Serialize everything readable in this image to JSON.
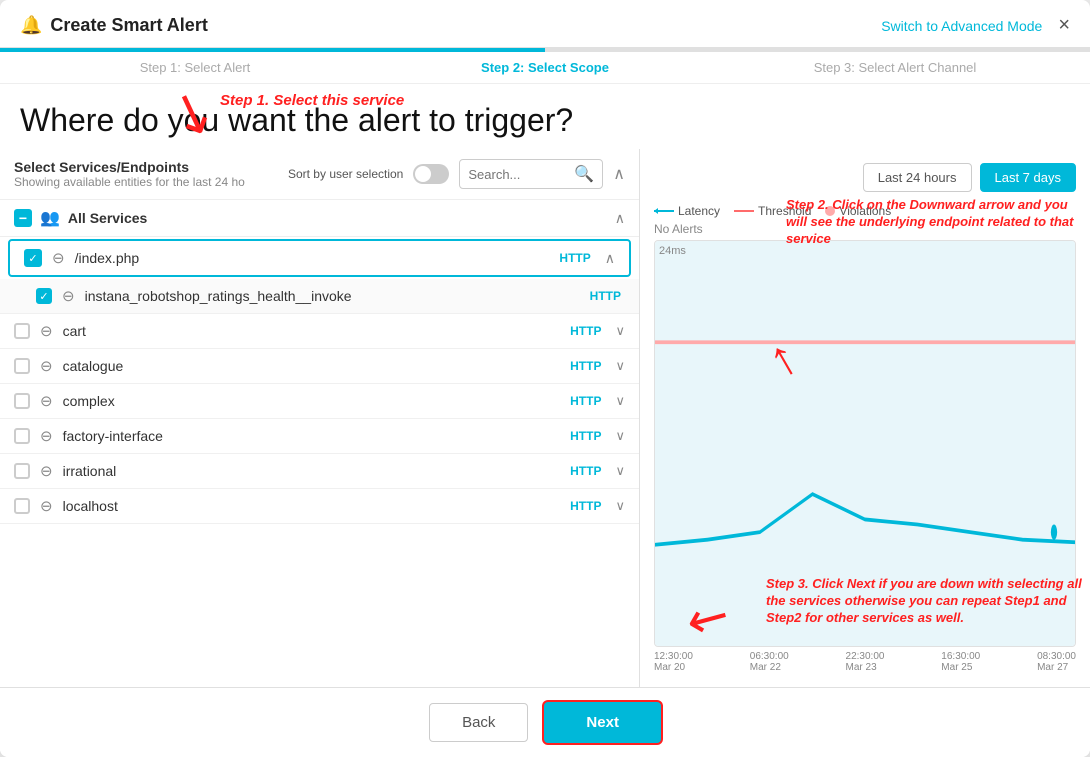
{
  "modal": {
    "title": "Create Smart Alert",
    "advanced_mode": "Switch to Advanced Mode",
    "close": "×"
  },
  "steps": [
    {
      "label": "Step 1: Select Alert",
      "state": "past"
    },
    {
      "label": "Step 2: Select Scope",
      "state": "active"
    },
    {
      "label": "Step 3: Select Alert Channel",
      "state": "future"
    }
  ],
  "page_title": "Where do you want the alert to trigger?",
  "left_panel": {
    "header": "Select Services/Endpoints",
    "subheader": "Showing available entities for the last 24 ho",
    "sort_label": "Sort by user selection",
    "search_placeholder": "Search...",
    "all_services_label": "All Services"
  },
  "services": [
    {
      "name": "/index.php",
      "badge": "HTTP",
      "checked": true,
      "indented": false,
      "expanded": true
    },
    {
      "name": "instana_robotshop_ratings_health__invoke",
      "badge": "HTTP",
      "checked": true,
      "indented": true,
      "expanded": false
    },
    {
      "name": "cart",
      "badge": "HTTP",
      "checked": false,
      "indented": false,
      "expanded": false
    },
    {
      "name": "catalogue",
      "badge": "HTTP",
      "checked": false,
      "indented": false,
      "expanded": false
    },
    {
      "name": "complex",
      "badge": "HTTP",
      "checked": false,
      "indented": false,
      "expanded": false
    },
    {
      "name": "factory-interface",
      "badge": "HTTP",
      "checked": false,
      "indented": false,
      "expanded": false
    },
    {
      "name": "irrational",
      "badge": "HTTP",
      "checked": false,
      "indented": false,
      "expanded": false
    },
    {
      "name": "localhost",
      "badge": "HTTP",
      "checked": false,
      "indented": false,
      "expanded": false
    }
  ],
  "right_panel": {
    "time_buttons": [
      "Last 24 hours",
      "Last 7 days"
    ],
    "active_time": "Last 7 days",
    "no_alerts": "No Alerts",
    "chart_y_label": "24ms",
    "legend": [
      {
        "name": "Latency",
        "type": "line",
        "color": "#00b8d9"
      },
      {
        "name": "Threshold",
        "type": "line",
        "color": "#ff6b6b"
      },
      {
        "name": "Violations",
        "type": "dot",
        "color": "#ffcccc"
      }
    ],
    "x_labels": [
      {
        "time": "12:30:00",
        "date": "Mar 20"
      },
      {
        "time": "06:30:00",
        "date": "Mar 22"
      },
      {
        "time": "22:30:00",
        "date": "Mar 23"
      },
      {
        "time": "16:30:00",
        "date": "Mar 25"
      },
      {
        "time": "08:30:00",
        "date": "Mar 27"
      }
    ]
  },
  "annotations": {
    "step1": "Step 1. Select this service",
    "step2": "Step 2. Click on the Downward arrow and you will see the underlying endpoint related to that service",
    "step3": "Step 3. Click Next if you are down with selecting all the services otherwise you can repeat Step1 and Step2 for other services as well."
  },
  "footer": {
    "back_label": "Back",
    "next_label": "Next"
  }
}
